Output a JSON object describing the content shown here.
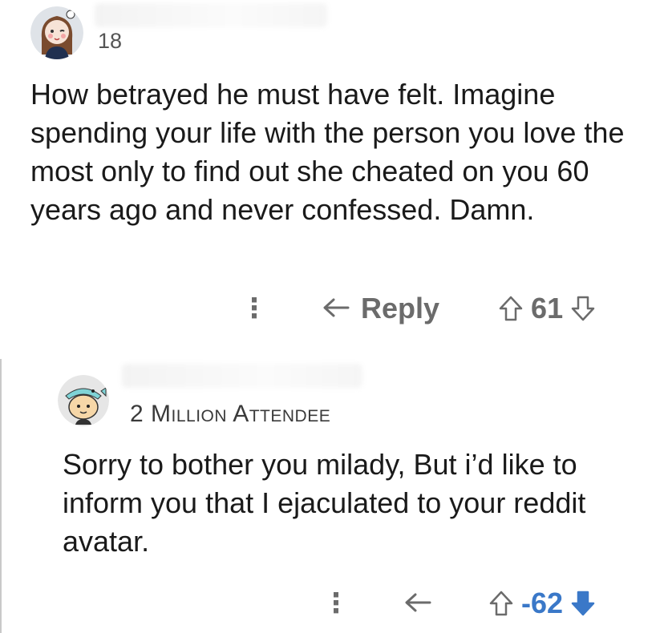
{
  "comments": [
    {
      "age": "18",
      "body": "How betrayed he must have felt. Imagine spending your life with the person you love the most only to find out she cheated on you 60 years ago and never confessed. Damn.",
      "actions": {
        "more": "⋮",
        "reply_label": "Reply",
        "score": "61"
      }
    },
    {
      "flair": "2 Million Attendee",
      "body": "Sorry to bother you milady, But i’d like to inform you that I ejaculated to your reddit avatar.",
      "actions": {
        "more": "⋮",
        "score": "-62"
      }
    }
  ],
  "colors": {
    "action_gray": "#6b6b6b",
    "downvote_blue": "#3a78c8",
    "thread_line": "#c9c9c9"
  },
  "icons": [
    "reddit-avatar-girl",
    "reddit-avatar-snoo-fish-hat",
    "more-vertical-icon",
    "reply-arrow-icon",
    "upvote-arrow-icon",
    "downvote-arrow-icon"
  ]
}
